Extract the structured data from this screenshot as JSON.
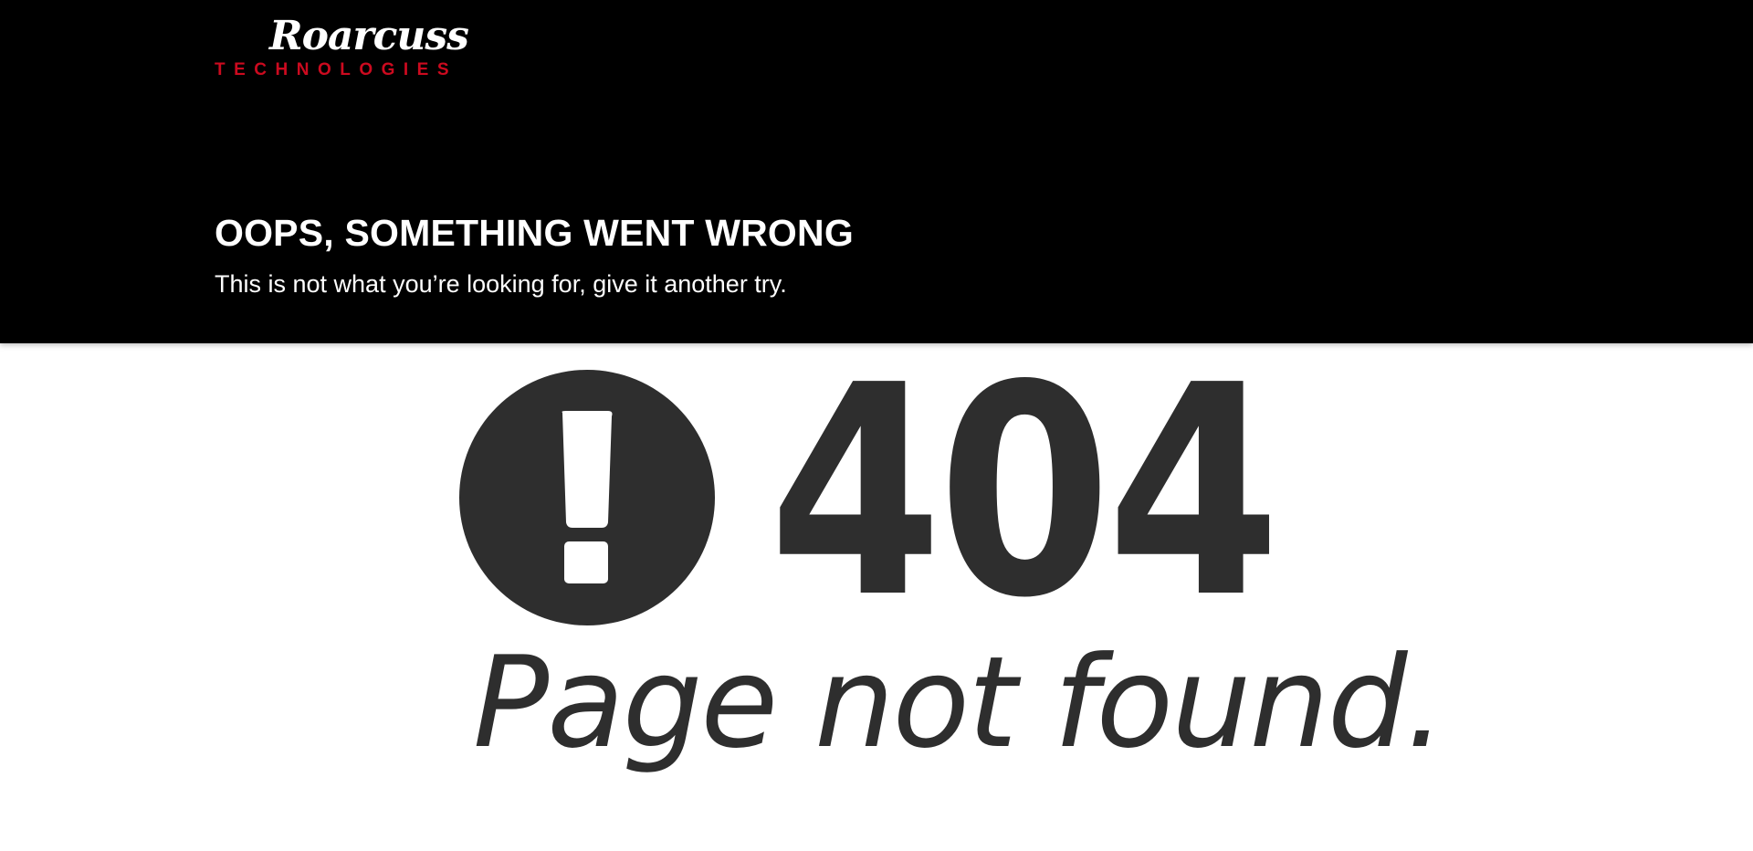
{
  "brand": {
    "name": "Roarcuss",
    "tagline": "TECHNOLOGIES",
    "accent_color": "#cc0a1f"
  },
  "hero": {
    "heading": "OOPS, SOMETHING WENT WRONG",
    "subheading": "This is not what you’re looking for, give it another try.",
    "background_color": "#000000"
  },
  "error": {
    "icon": "exclamation-circle-icon",
    "code": "404",
    "message": "Page not found.",
    "color": "#2e2e2e"
  }
}
